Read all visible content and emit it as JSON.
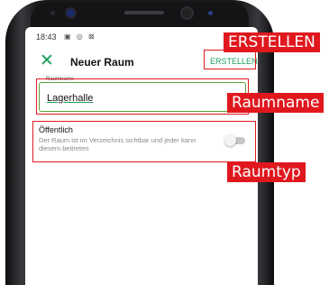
{
  "status_bar": {
    "time": "18:43",
    "icons": "▣ ◎ ⊠",
    "wifi": "◈"
  },
  "app_bar": {
    "close_icon": "close-icon",
    "title": "Neuer Raum",
    "create_label": "ERSTELLEN"
  },
  "room_name": {
    "label": "Raumname",
    "value": "Lagerhalle"
  },
  "public": {
    "title": "Öffentlich",
    "description": "Der Raum ist im Verzeichnis sichtbar und jeder kann diesem beitreten",
    "enabled": false
  },
  "annotations": {
    "create": "ERSTELLEN",
    "name": "Raumname",
    "type": "Raumtyp"
  },
  "colors": {
    "accent": "#1a9e5a",
    "annotation": "#e0181e",
    "field_border": "#5aa33a"
  }
}
